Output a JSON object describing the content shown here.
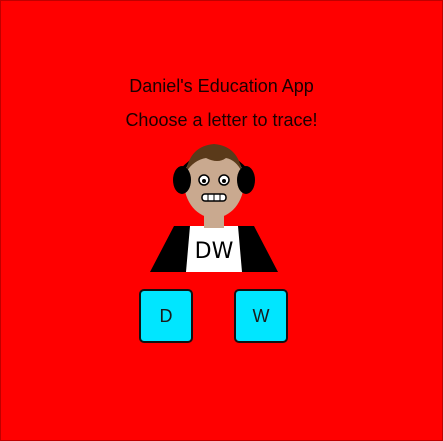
{
  "app": {
    "title": "Daniel's Education App",
    "subtitle": "Choose a letter to trace!",
    "background_color": "#ff0000"
  },
  "avatar": {
    "shirt_text": "DW",
    "icon": "cartoon-person-with-headphones"
  },
  "letters": [
    {
      "label": "D",
      "color": "#00e6ff"
    },
    {
      "label": "W",
      "color": "#00e6ff"
    }
  ]
}
